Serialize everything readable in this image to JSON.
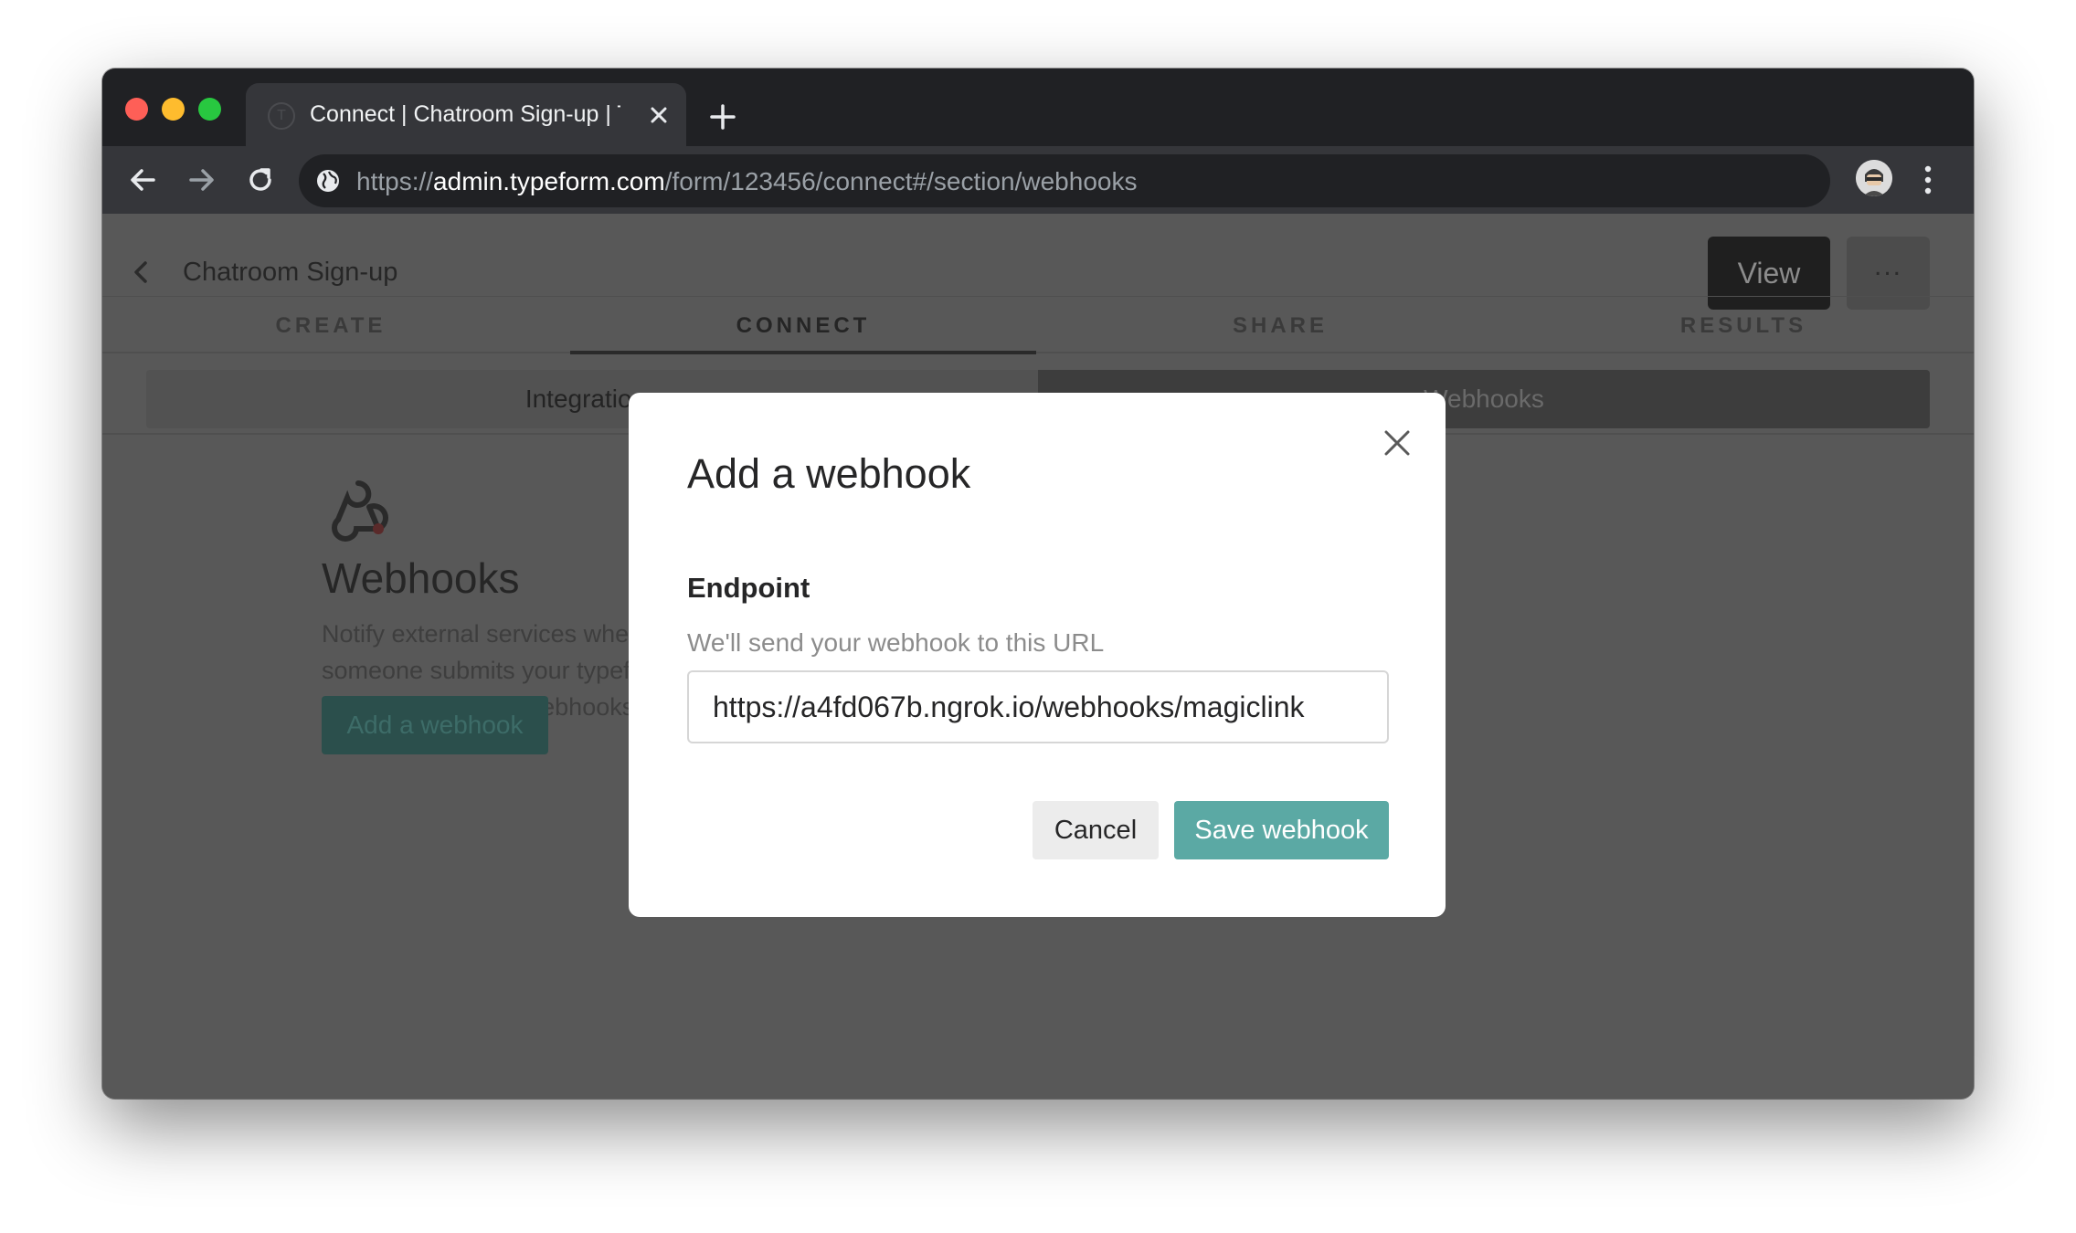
{
  "browser": {
    "tab_title": "Connect | Chatroom Sign-up | Typeform",
    "url_scheme": "https://",
    "url_host": "admin.typeform.com",
    "url_path": "/form/123456/connect#/section/webhooks"
  },
  "page": {
    "form_title": "Chatroom Sign-up",
    "view_label": "View",
    "more_label": "...",
    "tabs": [
      "CREATE",
      "CONNECT",
      "SHARE",
      "RESULTS"
    ],
    "active_tab": "CONNECT",
    "subnav": {
      "left": "Integrations",
      "right": "Webhooks"
    },
    "webhooks": {
      "title": "Webhooks",
      "description": "Notify external services when someone submits your typeform. Learn more about webhooks",
      "add_label": "Add a webhook"
    }
  },
  "modal": {
    "title": "Add a webhook",
    "field_label": "Endpoint",
    "field_help": "We'll send your webhook to this URL",
    "endpoint_value": "https://a4fd067b.ngrok.io/webhooks/magiclink",
    "cancel_label": "Cancel",
    "save_label": "Save webhook"
  },
  "colors": {
    "accent": "#5ba9a4",
    "overlay": "#585858",
    "chrome_dark": "#202124"
  },
  "icons": [
    "favicon-icon",
    "close-tab-icon",
    "new-tab-icon",
    "back-arrow-icon",
    "forward-arrow-icon",
    "reload-icon",
    "site-info-icon",
    "profile-avatar-icon",
    "more-vert-icon",
    "chevron-left-icon",
    "webhook-logo-icon",
    "close-icon"
  ]
}
